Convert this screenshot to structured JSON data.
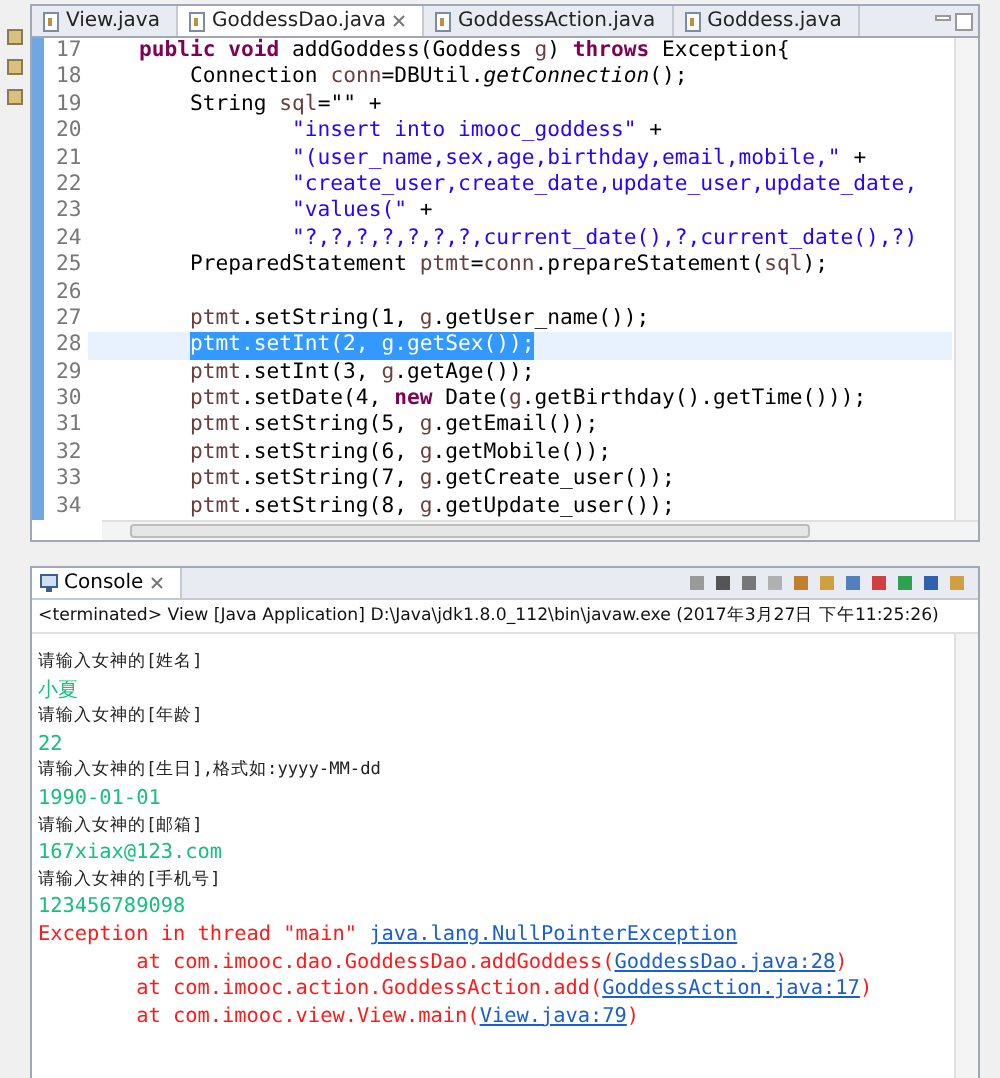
{
  "editor": {
    "tabs": [
      {
        "label": "View.java",
        "selected": false
      },
      {
        "label": "GoddessDao.java",
        "selected": true
      },
      {
        "label": "GoddessAction.java",
        "selected": false
      },
      {
        "label": "Goddess.java",
        "selected": false
      }
    ],
    "lines": [
      {
        "number": "17",
        "kind": "method",
        "selected": false,
        "tokens": [
          {
            "kind": "kw",
            "text": "public void"
          },
          {
            "kind": "plain",
            "text": " addGoddess(Goddess "
          },
          {
            "kind": "var",
            "text": "g"
          },
          {
            "kind": "plain",
            "text": ") "
          },
          {
            "kind": "kw",
            "text": "throws"
          },
          {
            "kind": "plain",
            "text": " Exception{"
          }
        ]
      },
      {
        "number": "18",
        "kind": "body",
        "selected": false,
        "tokens": [
          {
            "kind": "plain",
            "text": "Connection "
          },
          {
            "kind": "var",
            "text": "conn"
          },
          {
            "kind": "plain",
            "text": "=DBUtil."
          },
          {
            "kind": "ital",
            "text": "getConnection"
          },
          {
            "kind": "plain",
            "text": "();"
          }
        ]
      },
      {
        "number": "19",
        "kind": "body",
        "selected": false,
        "tokens": [
          {
            "kind": "plain",
            "text": "String "
          },
          {
            "kind": "var",
            "text": "sql"
          },
          {
            "kind": "plain",
            "text": "=\"\" +"
          }
        ]
      },
      {
        "number": "20",
        "kind": "continuation",
        "selected": false,
        "tokens": [
          {
            "kind": "str",
            "text": "\"insert into imooc_goddess\""
          },
          {
            "kind": "plain",
            "text": " +"
          }
        ]
      },
      {
        "number": "21",
        "kind": "continuation",
        "selected": false,
        "tokens": [
          {
            "kind": "str",
            "text": "\"(user_name,sex,age,birthday,email,mobile,\""
          },
          {
            "kind": "plain",
            "text": " +"
          }
        ]
      },
      {
        "number": "22",
        "kind": "continuation",
        "selected": false,
        "tokens": [
          {
            "kind": "str",
            "text": "\"create_user,create_date,update_user,update_date,"
          }
        ]
      },
      {
        "number": "23",
        "kind": "continuation",
        "selected": false,
        "tokens": [
          {
            "kind": "str",
            "text": "\"values(\""
          },
          {
            "kind": "plain",
            "text": " +"
          }
        ]
      },
      {
        "number": "24",
        "kind": "continuation",
        "selected": false,
        "tokens": [
          {
            "kind": "str",
            "text": "\"?,?,?,?,?,?,?,current_date(),?,current_date(),?)"
          }
        ]
      },
      {
        "number": "25",
        "kind": "body",
        "selected": false,
        "tokens": [
          {
            "kind": "plain",
            "text": "PreparedStatement "
          },
          {
            "kind": "var",
            "text": "ptmt"
          },
          {
            "kind": "plain",
            "text": "="
          },
          {
            "kind": "var",
            "text": "conn"
          },
          {
            "kind": "plain",
            "text": ".prepareStatement("
          },
          {
            "kind": "var",
            "text": "sql"
          },
          {
            "kind": "plain",
            "text": ");"
          }
        ]
      },
      {
        "number": "26",
        "kind": "blank",
        "selected": false
      },
      {
        "number": "27",
        "kind": "body",
        "selected": false,
        "tokens": [
          {
            "kind": "var",
            "text": "ptmt"
          },
          {
            "kind": "plain",
            "text": ".setString(1, "
          },
          {
            "kind": "var",
            "text": "g"
          },
          {
            "kind": "plain",
            "text": ".getUser_name());"
          }
        ]
      },
      {
        "number": "28",
        "kind": "body",
        "selected": true,
        "tokens": [
          {
            "kind": "var",
            "text": "ptmt"
          },
          {
            "kind": "plain",
            "text": ".setInt(2, "
          },
          {
            "kind": "var",
            "text": "g"
          },
          {
            "kind": "plain",
            "text": ".getSex());"
          }
        ]
      },
      {
        "number": "29",
        "kind": "body",
        "selected": false,
        "tokens": [
          {
            "kind": "var",
            "text": "ptmt"
          },
          {
            "kind": "plain",
            "text": ".setInt(3, "
          },
          {
            "kind": "var",
            "text": "g"
          },
          {
            "kind": "plain",
            "text": ".getAge());"
          }
        ]
      },
      {
        "number": "30",
        "kind": "body",
        "selected": false,
        "tokens": [
          {
            "kind": "var",
            "text": "ptmt"
          },
          {
            "kind": "plain",
            "text": ".setDate(4, "
          },
          {
            "kind": "kw",
            "text": "new"
          },
          {
            "kind": "plain",
            "text": " Date("
          },
          {
            "kind": "var",
            "text": "g"
          },
          {
            "kind": "plain",
            "text": ".getBirthday().getTime()));"
          }
        ]
      },
      {
        "number": "31",
        "kind": "body",
        "selected": false,
        "tokens": [
          {
            "kind": "var",
            "text": "ptmt"
          },
          {
            "kind": "plain",
            "text": ".setString(5, "
          },
          {
            "kind": "var",
            "text": "g"
          },
          {
            "kind": "plain",
            "text": ".getEmail());"
          }
        ]
      },
      {
        "number": "32",
        "kind": "body",
        "selected": false,
        "tokens": [
          {
            "kind": "var",
            "text": "ptmt"
          },
          {
            "kind": "plain",
            "text": ".setString(6, "
          },
          {
            "kind": "var",
            "text": "g"
          },
          {
            "kind": "plain",
            "text": ".getMobile());"
          }
        ]
      },
      {
        "number": "33",
        "kind": "body",
        "selected": false,
        "tokens": [
          {
            "kind": "var",
            "text": "ptmt"
          },
          {
            "kind": "plain",
            "text": ".setString(7, "
          },
          {
            "kind": "var",
            "text": "g"
          },
          {
            "kind": "plain",
            "text": ".getCreate_user());"
          }
        ]
      },
      {
        "number": "34",
        "kind": "body",
        "selected": false,
        "tokens": [
          {
            "kind": "var",
            "text": "ptmt"
          },
          {
            "kind": "plain",
            "text": ".setString(8, "
          },
          {
            "kind": "var",
            "text": "g"
          },
          {
            "kind": "plain",
            "text": ".getUpdate_user());"
          }
        ]
      }
    ]
  },
  "console": {
    "title": "Console",
    "status": "<terminated> View [Java Application] D:\\Java\\jdk1.8.0_112\\bin\\javaw.exe (2017年3月27日 下午11:25:26)",
    "lines": [
      {
        "kind": "prompt",
        "segments": [
          {
            "text": "请输入女神的[姓名]",
            "link": false
          }
        ]
      },
      {
        "kind": "input",
        "segments": [
          {
            "text": "小夏",
            "link": false
          }
        ]
      },
      {
        "kind": "prompt",
        "segments": [
          {
            "text": "请输入女神的[年龄]",
            "link": false
          }
        ]
      },
      {
        "kind": "input",
        "segments": [
          {
            "text": "22",
            "link": false
          }
        ]
      },
      {
        "kind": "prompt",
        "segments": [
          {
            "text": "请输入女神的[生日],格式如:yyyy-MM-dd",
            "link": false
          }
        ]
      },
      {
        "kind": "input",
        "segments": [
          {
            "text": "1990-01-01",
            "link": false
          }
        ]
      },
      {
        "kind": "prompt",
        "segments": [
          {
            "text": "请输入女神的[邮箱]",
            "link": false
          }
        ]
      },
      {
        "kind": "input",
        "segments": [
          {
            "text": "167xiax@123.com",
            "link": false
          }
        ]
      },
      {
        "kind": "prompt",
        "segments": [
          {
            "text": "请输入女神的[手机号]",
            "link": false
          }
        ]
      },
      {
        "kind": "input",
        "segments": [
          {
            "text": "123456789098",
            "link": false
          }
        ]
      },
      {
        "kind": "error",
        "segments": [
          {
            "text": "Exception in thread \"main\" ",
            "link": false
          },
          {
            "text": "java.lang.NullPointerException",
            "link": true
          }
        ]
      },
      {
        "kind": "trace",
        "segments": [
          {
            "text": "at com.imooc.dao.GoddessDao.addGoddess(",
            "link": false
          },
          {
            "text": "GoddessDao.java:28",
            "link": true
          },
          {
            "text": ")",
            "link": false
          }
        ]
      },
      {
        "kind": "trace",
        "segments": [
          {
            "text": "at com.imooc.action.GoddessAction.add(",
            "link": false
          },
          {
            "text": "GoddessAction.java:17",
            "link": true
          },
          {
            "text": ")",
            "link": false
          }
        ]
      },
      {
        "kind": "trace",
        "segments": [
          {
            "text": "at com.imooc.view.View.main(",
            "link": false
          },
          {
            "text": "View.java:79",
            "link": true
          },
          {
            "text": ")",
            "link": false
          }
        ]
      }
    ]
  }
}
